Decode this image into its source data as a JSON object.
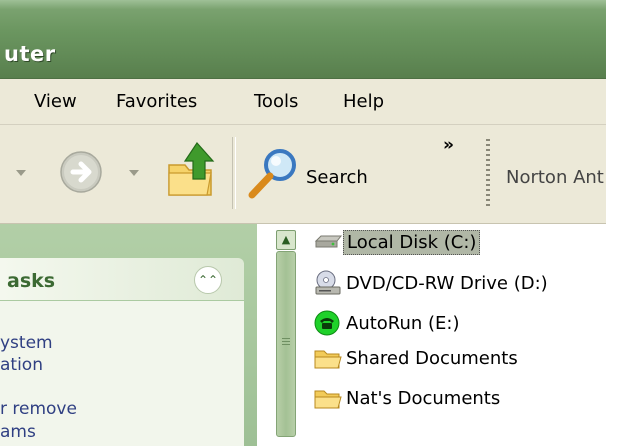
{
  "window": {
    "title": "uter"
  },
  "menu": {
    "items": [
      "View",
      "Favorites",
      "Tools",
      "Help"
    ]
  },
  "toolbar": {
    "search_label": "Search",
    "more_label": "»",
    "norton_label": "Norton Ant"
  },
  "tasks": {
    "title": "asks",
    "links": [
      "ystem",
      "ation",
      "r remove",
      "ams"
    ]
  },
  "files": [
    {
      "name": "Local Disk (C:)",
      "icon": "hard-drive-icon",
      "selected": true
    },
    {
      "name": "DVD/CD-RW Drive (D:)",
      "icon": "cd-drive-icon",
      "selected": false
    },
    {
      "name": "AutoRun (E:)",
      "icon": "autorun-phone-icon",
      "selected": false
    },
    {
      "name": "Shared Documents",
      "icon": "folder-icon",
      "selected": false
    },
    {
      "name": "Nat's Documents",
      "icon": "folder-icon",
      "selected": false
    }
  ],
  "colors": {
    "title_bar": "#6b9660",
    "task_pane": "#a7c69d",
    "selection": "#b0b7a6"
  }
}
